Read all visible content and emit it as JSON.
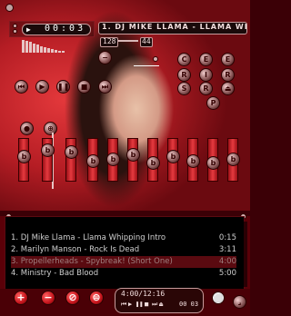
{
  "player": {
    "time_display": "00:03",
    "track_title": "1. DJ MIKE LLAMA - LLAMA WHIPPI",
    "kbps": "128",
    "khz": "44",
    "right_buttons_row1": [
      "C",
      "E",
      "E"
    ],
    "right_buttons_row2": [
      "R",
      "I",
      "R"
    ],
    "transport_right": [
      "S",
      "R"
    ],
    "pl_button": "P",
    "eq_letters": [
      "b",
      "b",
      "b",
      "b",
      "b",
      "b",
      "b",
      "b",
      "b",
      "b",
      "b"
    ],
    "eq_levels": [
      0.85,
      1.0,
      0.95,
      0.75,
      0.8,
      0.9,
      0.7,
      0.85,
      0.75,
      0.7,
      0.8
    ]
  },
  "playlist": {
    "items": [
      {
        "title": "1. DJ Mike Llama - Llama Whipping Intro",
        "duration": "0:15"
      },
      {
        "title": "2. Marilyn Manson - Rock Is Dead",
        "duration": "3:11"
      },
      {
        "title": "3. Propellerheads - Spybreak! (Short One)",
        "duration": "4:00"
      },
      {
        "title": "4. Ministry - Bad Blood",
        "duration": "5:00"
      }
    ],
    "selected_index": 2,
    "total_time": "4:00/12:16",
    "mini_time": "00 03",
    "colors": {
      "selected_bg": "#5a0a10",
      "text": "#cfcfcf"
    }
  }
}
